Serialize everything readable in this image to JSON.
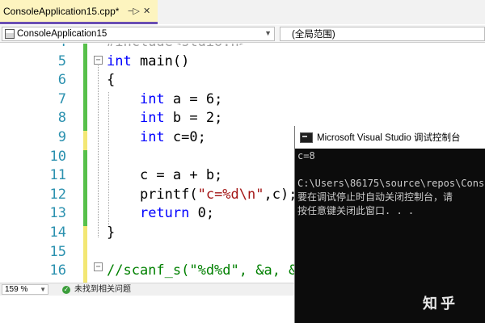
{
  "tab": {
    "title": "ConsoleApplication15.cpp*",
    "pin_icon": "pin-icon",
    "close_icon": "close-icon"
  },
  "nav": {
    "project": "ConsoleApplication15",
    "scope": "(全局范围)"
  },
  "editor": {
    "line_numbers": [
      "4",
      "5",
      "6",
      "7",
      "8",
      "9",
      "10",
      "11",
      "12",
      "13",
      "14",
      "15",
      "16"
    ],
    "lines": [
      {
        "text": "#include<stdio.h>",
        "cls": "faded"
      },
      {
        "parts": [
          {
            "t": "int",
            "c": "kw"
          },
          {
            "t": " main()"
          }
        ]
      },
      {
        "parts": [
          {
            "t": "{"
          }
        ]
      },
      {
        "parts": [
          {
            "t": "    "
          },
          {
            "t": "int",
            "c": "kw"
          },
          {
            "t": " a = 6;"
          }
        ]
      },
      {
        "parts": [
          {
            "t": "    "
          },
          {
            "t": "int",
            "c": "kw"
          },
          {
            "t": " b = 2;"
          }
        ]
      },
      {
        "parts": [
          {
            "t": "    "
          },
          {
            "t": "int",
            "c": "kw"
          },
          {
            "t": " c=0;"
          }
        ]
      },
      {
        "parts": [
          {
            "t": ""
          }
        ]
      },
      {
        "parts": [
          {
            "t": "    c = a + b;"
          }
        ]
      },
      {
        "parts": [
          {
            "t": "    printf("
          },
          {
            "t": "\"c=%d\\n\"",
            "c": "str"
          },
          {
            "t": ",c);"
          }
        ]
      },
      {
        "parts": [
          {
            "t": "    "
          },
          {
            "t": "return",
            "c": "kw"
          },
          {
            "t": " 0;"
          }
        ]
      },
      {
        "parts": [
          {
            "t": "}"
          }
        ]
      },
      {
        "parts": [
          {
            "t": ""
          }
        ]
      },
      {
        "parts": [
          {
            "t": "//scanf_s(\"%d%d\", &a, &b)",
            "c": "cmt"
          }
        ]
      }
    ],
    "change_marks": [
      "green",
      "green",
      "green",
      "green",
      "green",
      "yellow",
      "green",
      "green",
      "green",
      "green",
      "yellow",
      "yellow",
      "yellow"
    ]
  },
  "status": {
    "zoom": "159 %",
    "issues": "未找到相关问题"
  },
  "console": {
    "title": "Microsoft Visual Studio 调试控制台",
    "lines": [
      "c=8",
      "",
      "C:\\Users\\86175\\source\\repos\\Cons",
      "要在调试停止时自动关闭控制台，请",
      "按任意键关闭此窗口. . ."
    ]
  },
  "watermark": "知乎",
  "colors": {
    "tab_active": "#fdf4bf",
    "tab_accent": "#6a4fb3",
    "keyword": "#0000ff",
    "string": "#a31515",
    "comment": "#008000",
    "line_number": "#2b91af",
    "change_saved": "#57c04a",
    "change_unsaved": "#f3e774"
  }
}
